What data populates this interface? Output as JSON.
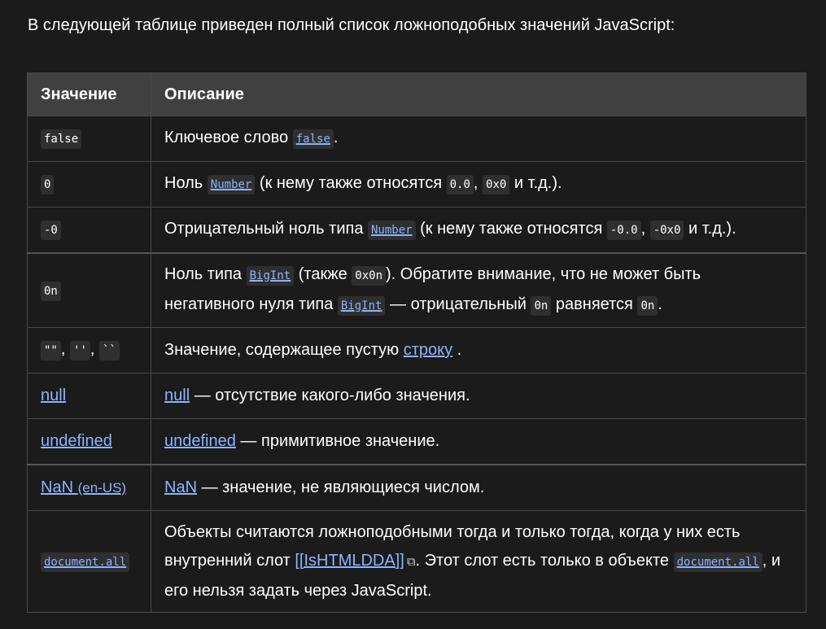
{
  "intro": "В следующей таблице приведен полный список ложноподобных значений JavaScript:",
  "headers": {
    "value": "Значение",
    "description": "Описание"
  },
  "rows": {
    "r1": {
      "value": "false",
      "d1": "Ключевое слово ",
      "c1": "false",
      "d2": "."
    },
    "r2": {
      "value": "0",
      "d1": "Ноль ",
      "c1": "Number",
      "d2": " (к нему также относятся ",
      "c2": "0.0",
      "d3": ", ",
      "c3": "0x0",
      "d4": " и т.д.)."
    },
    "r3": {
      "value": "-0",
      "d1": "Отрицательный ноль типа ",
      "c1": "Number",
      "d2": " (к нему также относятся ",
      "c2": "-0.0",
      "d3": ", ",
      "c3": "-0x0",
      "d4": " и т.д.)."
    },
    "r4": {
      "value": "0n",
      "d1": "Ноль типа ",
      "c1": "BigInt",
      "d2": " (также ",
      "c2": "0x0n",
      "d3": "). Обратите внимание, что не может быть негативного нуля типа ",
      "c3": "BigInt",
      "d4": " — отрицательный ",
      "c4": "0n",
      "d5": " равняется ",
      "c5": "0n",
      "d6": "."
    },
    "r5": {
      "v1": "\"\"",
      "sep1": ", ",
      "v2": "''",
      "sep2": ", ",
      "v3": "``",
      "d1": "Значение, содержащее пустую ",
      "l1": "строку",
      "d2": " ."
    },
    "r6": {
      "value": "null",
      "l1": "null",
      "d1": " — отсутствие какого-либо значения."
    },
    "r7": {
      "value": "undefined",
      "l1": "undefined",
      "d1": " — примитивное значение."
    },
    "r8": {
      "value": "NaN",
      "value_locale": "(en-US)",
      "l1": "NaN",
      "d1": " — значение, не являющиеся числом."
    },
    "r9": {
      "value": "document.all",
      "d1": "Объекты считаются ложноподобными тогда и только тогда, когда у них есть внутренний слот ",
      "l1": "[[IsHTMLDDA]]",
      "ext_icon": "external-link-icon",
      "d2": ". Этот слот есть только в объекте ",
      "c1": "document.all",
      "d3": ", и его нельзя задать через JavaScript."
    }
  },
  "colors": {
    "background": "#1b1b1b",
    "header": "#404040",
    "link": "#8cb4ff",
    "border": "#4a4a4a"
  }
}
